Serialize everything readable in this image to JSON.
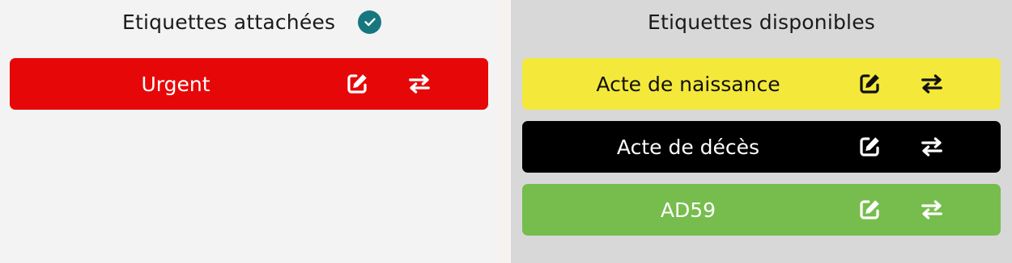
{
  "attached": {
    "title": "Etiquettes attachées",
    "check_icon": "check-circle-icon",
    "badge_color": "#16777f",
    "tags": [
      {
        "label": "Urgent",
        "bg": "#e60808",
        "fg": "#ffffff",
        "edit_icon": "edit-icon",
        "transfer_icon": "transfer-icon"
      }
    ]
  },
  "available": {
    "title": "Etiquettes disponibles",
    "tags": [
      {
        "label": "Acte de naissance",
        "bg": "#f4e93a",
        "fg": "#111111",
        "edit_icon": "edit-icon",
        "transfer_icon": "transfer-icon"
      },
      {
        "label": "Acte de décès",
        "bg": "#000000",
        "fg": "#ffffff",
        "edit_icon": "edit-icon",
        "transfer_icon": "transfer-icon"
      },
      {
        "label": "AD59",
        "bg": "#76bd4d",
        "fg": "#ffffff",
        "edit_icon": "edit-icon",
        "transfer_icon": "transfer-icon"
      }
    ]
  }
}
